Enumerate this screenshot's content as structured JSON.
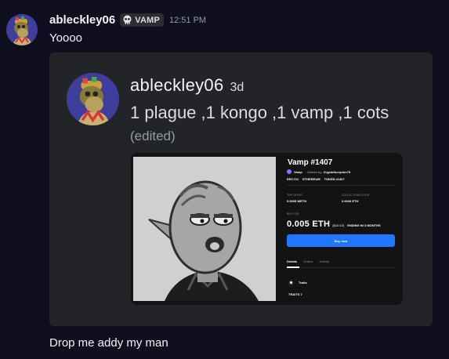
{
  "message": {
    "username": "ableckley06",
    "tag": "VAMP",
    "tag_icon": "skull-icon",
    "timestamp": "12:51 PM",
    "text": "Yoooo",
    "followup_text": "Drop me addy my man"
  },
  "embed": {
    "author_name": "ableckley06",
    "author_time": "3d",
    "title": "1 plague ,1 kongo ,1 vamp ,1 cots",
    "edited": "(edited)",
    "nft": {
      "name": "Vamp #1407",
      "collection": "Vamp",
      "owned_by_label": "Owned by",
      "owner": "CryptoScorpion79",
      "chips": [
        "ERC721",
        "ETHEREUM",
        "TOKEN #1407"
      ],
      "top_offer_label": "TOP OFFER",
      "top_offer_value": "0.0005 WETH",
      "collection_floor_label": "COLLECTION FLOOR",
      "collection_floor_value": "0.0033 ETH",
      "buy_for_label": "BUY FOR",
      "price": "0.005 ETH",
      "price_usd": "($10.10)",
      "ending": "ENDING IN 3 MONTHS",
      "buy_button": "Buy now",
      "tabs": [
        "Details",
        "Orders",
        "Activity"
      ],
      "traits_label": "Traits",
      "traits_count": "TRAITS 7"
    }
  },
  "colors": {
    "background": "#0f0f1f",
    "embed_bg": "#232428",
    "buy_button": "#1f76ff",
    "avatar_bg": "#3d3f9a"
  }
}
